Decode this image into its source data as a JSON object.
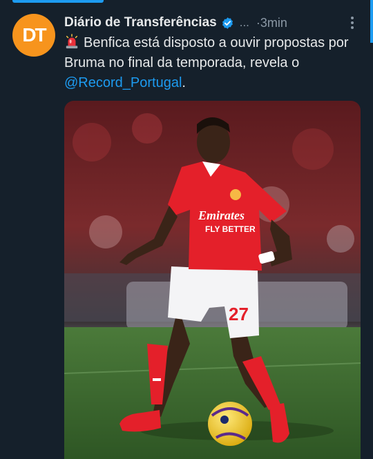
{
  "tweet": {
    "author_name": "Diário de Transferências",
    "ellipsis": "...",
    "time": "·3min",
    "avatar_initials": "DT",
    "text_part1": "Benfica está disposto a ouvir propostas por Bruma no final da temporada, revela o ",
    "mention": "@Record_Portugal",
    "text_end": ".",
    "media": {
      "jersey_sponsor_line1": "Emirates",
      "jersey_sponsor_line2": "FLY BETTER",
      "shorts_number": "27"
    }
  },
  "colors": {
    "background": "#15202b",
    "accent": "#1d9bf0",
    "avatar": "#f7941d",
    "kit_red": "#e4202a"
  },
  "icons": [
    "verified-badge-icon",
    "siren-emoji-icon",
    "more-options-icon"
  ]
}
